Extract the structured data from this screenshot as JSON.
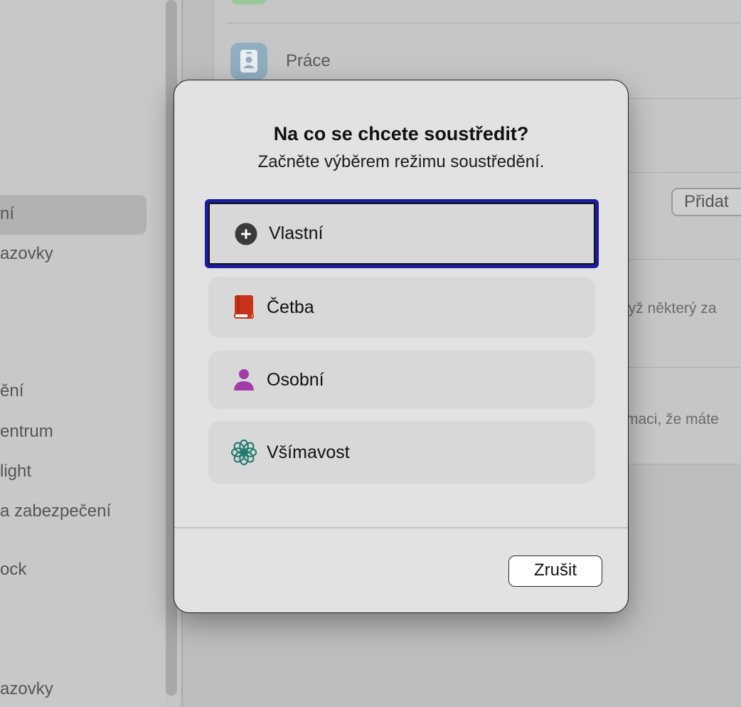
{
  "sidebar": {
    "items": [
      {
        "label": "ní",
        "selected": true
      },
      {
        "label": "azovky"
      },
      {
        "label": "ění"
      },
      {
        "label": "entrum"
      },
      {
        "label": "light"
      },
      {
        "label": "a zabezpečení"
      },
      {
        "label": "ock"
      },
      {
        "label": "azovky"
      }
    ]
  },
  "main": {
    "focus_modes": [
      {
        "label": "Práce",
        "icon": "id-badge-icon"
      }
    ],
    "add_button_label": "Přidat",
    "hint_text_1": "dyž některý za",
    "hint_text_2": "maci, že máte"
  },
  "dialog": {
    "title": "Na co se chcete soustředit?",
    "subtitle": "Začněte výběrem režimu soustředění.",
    "options": [
      {
        "label": "Vlastní",
        "icon": "plus-circle-icon",
        "color": "#3a3a3a",
        "focused": true
      },
      {
        "label": "Četba",
        "icon": "book-icon",
        "color": "#c8341a"
      },
      {
        "label": "Osobní",
        "icon": "person-icon",
        "color": "#a23aa8"
      },
      {
        "label": "Všímavost",
        "icon": "flower-icon",
        "color": "#1f7a6e"
      }
    ],
    "cancel_label": "Zrušit"
  }
}
